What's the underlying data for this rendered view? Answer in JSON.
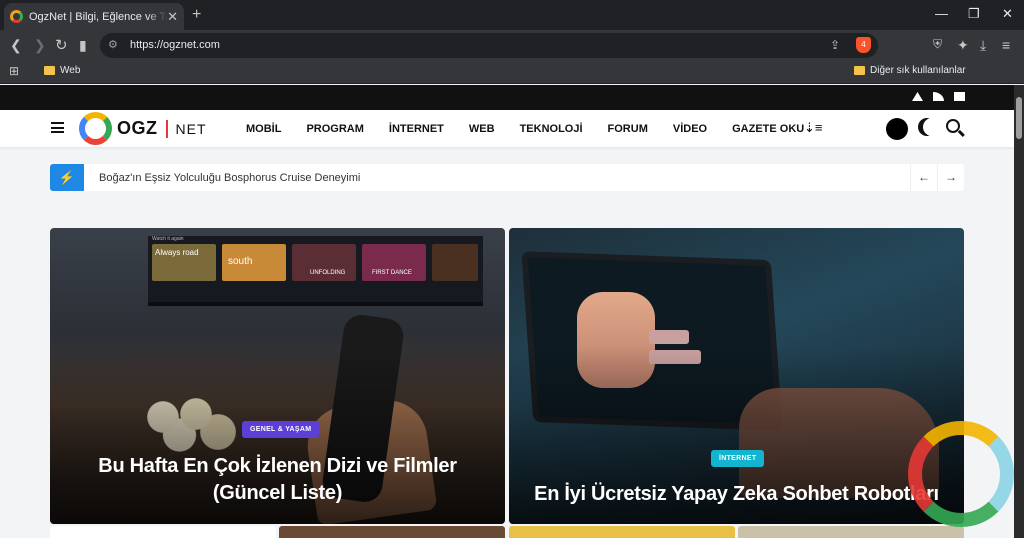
{
  "browser": {
    "tab_title": "OgzNet | Bilgi, Eğlence ve Teknoloji",
    "new_tab": "+",
    "url": "https://ogznet.com",
    "shield_badge": "4",
    "extensions_badge": "12",
    "bookmarks": {
      "web_label": "Web",
      "other_label": "Diğer sık kullanılanlar"
    },
    "window_controls": {
      "minimize": "—",
      "restore": "❐",
      "close": "✕"
    }
  },
  "site": {
    "logo": {
      "ogz": "OGZ",
      "net": "NET"
    },
    "nav": [
      "MOBİL",
      "PROGRAM",
      "İNTERNET",
      "WEB",
      "TEKNOLOJİ",
      "FORUM",
      "VİDEO",
      "GAZETE OKU"
    ],
    "ticker": {
      "icon": "bolt-icon",
      "text": "Boğaz'ın Eşsiz Yolculuğu Bosphorus Cruise Deneyimi",
      "prev": "←",
      "next": "→"
    },
    "cards": [
      {
        "category": "GENEL & YAŞAM",
        "category_color": "#5b3fd6",
        "title": "Bu Hafta En Çok İzlenen Dizi ve Filmler (Güncel Liste)"
      },
      {
        "category": "İNTERNET",
        "category_color": "#12b4cf",
        "title": "En İyi Ücretsiz Yapay Zeka Sohbet Robotları"
      }
    ],
    "tv_strip": {
      "heading": "Watch it again",
      "thumbs": [
        "Always road",
        "south",
        "UNFOLDING",
        "FIRST DANCE"
      ]
    }
  },
  "colors": {
    "accent_blue": "#1e88e5",
    "header_bg": "#ffffff",
    "page_bg": "#f3f4f6"
  }
}
